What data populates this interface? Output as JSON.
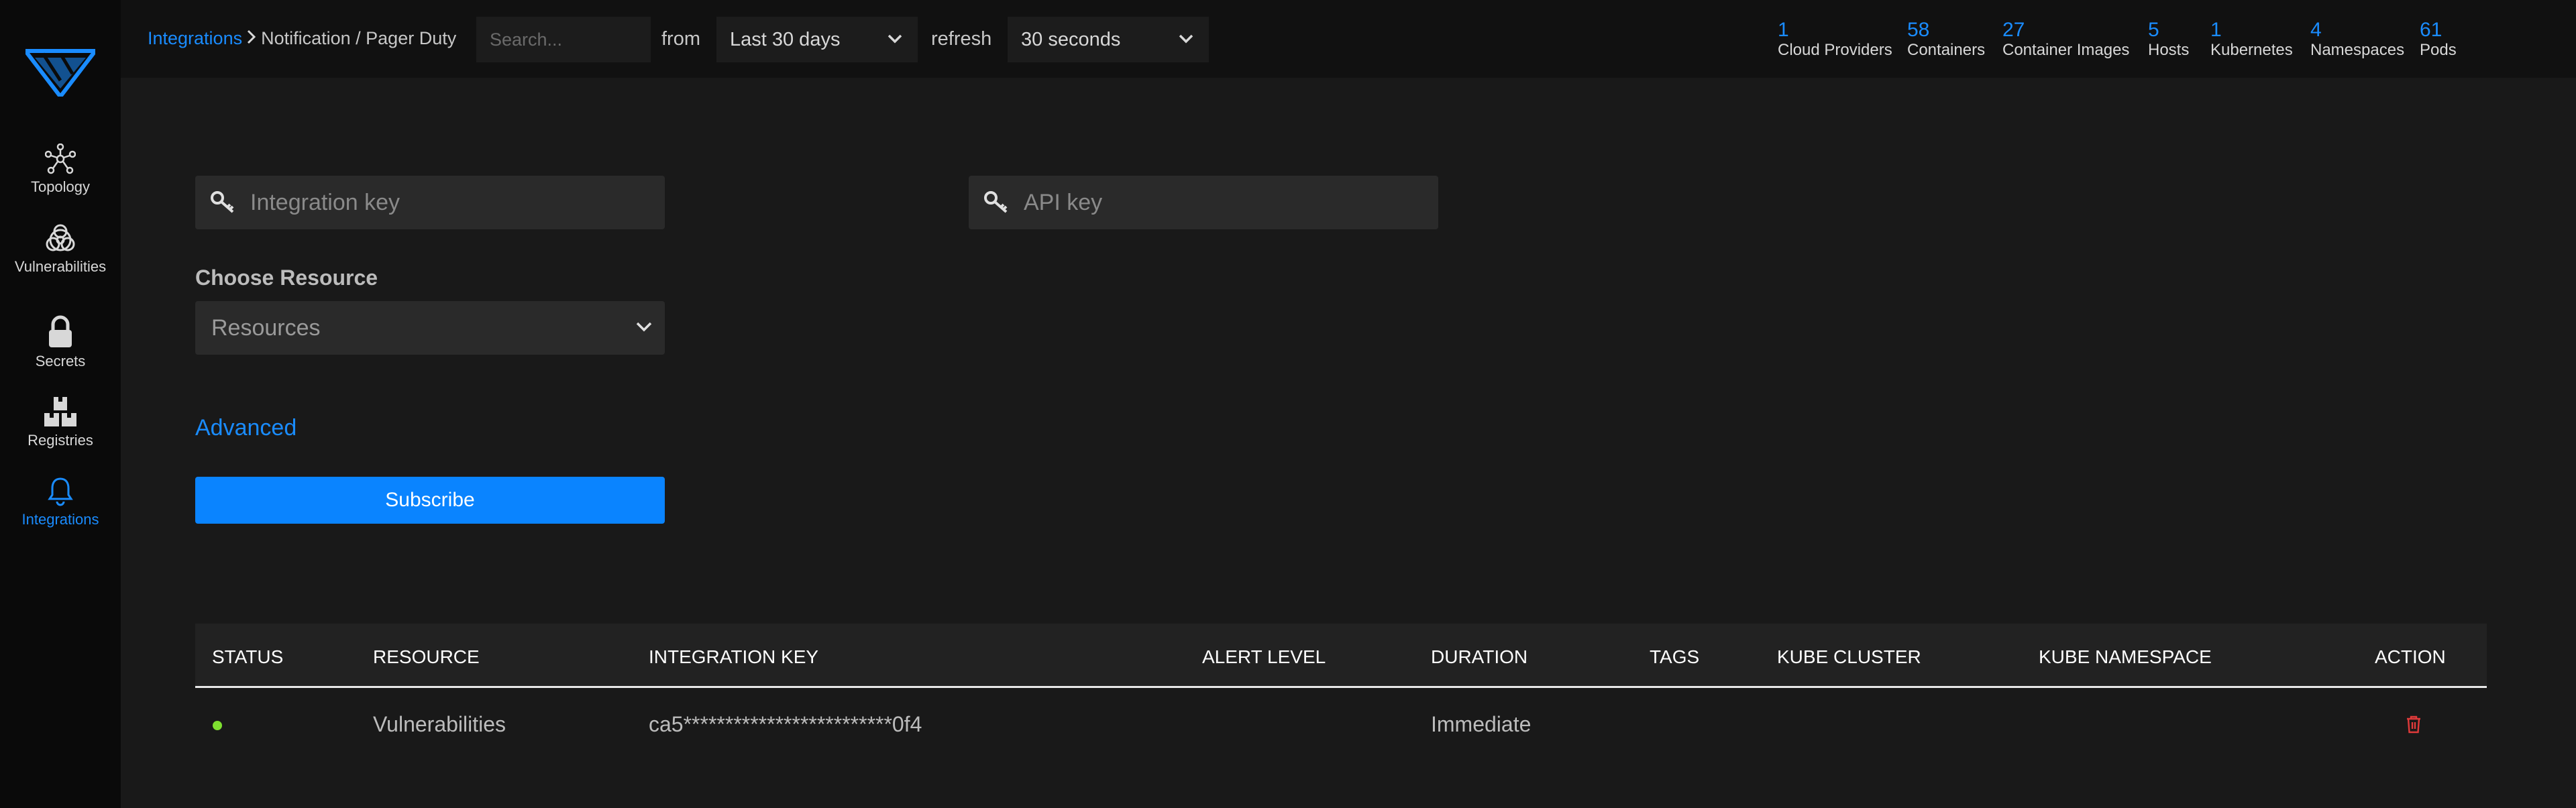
{
  "sidebar": {
    "items": [
      {
        "label": "Topology",
        "icon": "topology-icon",
        "active": false
      },
      {
        "label": "Vulnerabilities",
        "icon": "biohazard-icon",
        "active": false
      },
      {
        "label": "Secrets",
        "icon": "lock-icon",
        "active": false
      },
      {
        "label": "Registries",
        "icon": "boxes-icon",
        "active": false
      },
      {
        "label": "Integrations",
        "icon": "bell-icon",
        "active": true
      }
    ]
  },
  "header": {
    "breadcrumb_link": "Integrations",
    "breadcrumb_current": "Notification / Pager Duty",
    "search_placeholder": "Search...",
    "from_label": "from",
    "time_range": "Last 30 days",
    "refresh_label": "refresh",
    "refresh_interval": "30 seconds",
    "stats": [
      {
        "value": "1",
        "label": "Cloud Providers"
      },
      {
        "value": "58",
        "label": "Containers"
      },
      {
        "value": "27",
        "label": "Container Images"
      },
      {
        "value": "5",
        "label": "Hosts"
      },
      {
        "value": "1",
        "label": "Kubernetes"
      },
      {
        "value": "4",
        "label": "Namespaces"
      },
      {
        "value": "61",
        "label": "Pods"
      }
    ]
  },
  "form": {
    "integration_key_placeholder": "Integration key",
    "api_key_placeholder": "API key",
    "choose_resource_label": "Choose Resource",
    "resource_select_value": "Resources",
    "advanced_label": "Advanced",
    "subscribe_label": "Subscribe"
  },
  "table": {
    "columns": [
      "STATUS",
      "RESOURCE",
      "INTEGRATION KEY",
      "ALERT LEVEL",
      "DURATION",
      "TAGS",
      "KUBE CLUSTER",
      "KUBE NAMESPACE",
      "ACTION"
    ],
    "rows": [
      {
        "status_color": "#7ee030",
        "resource": "Vulnerabilities",
        "integration_key": "ca5*************************0f4",
        "alert_level": "",
        "duration": "Immediate",
        "tags": "",
        "kube_cluster": "",
        "kube_namespace": ""
      }
    ]
  },
  "colors": {
    "accent": "#1a8cff",
    "button": "#0a84ff",
    "danger": "#e03a3a",
    "status_ok": "#7ee030"
  }
}
